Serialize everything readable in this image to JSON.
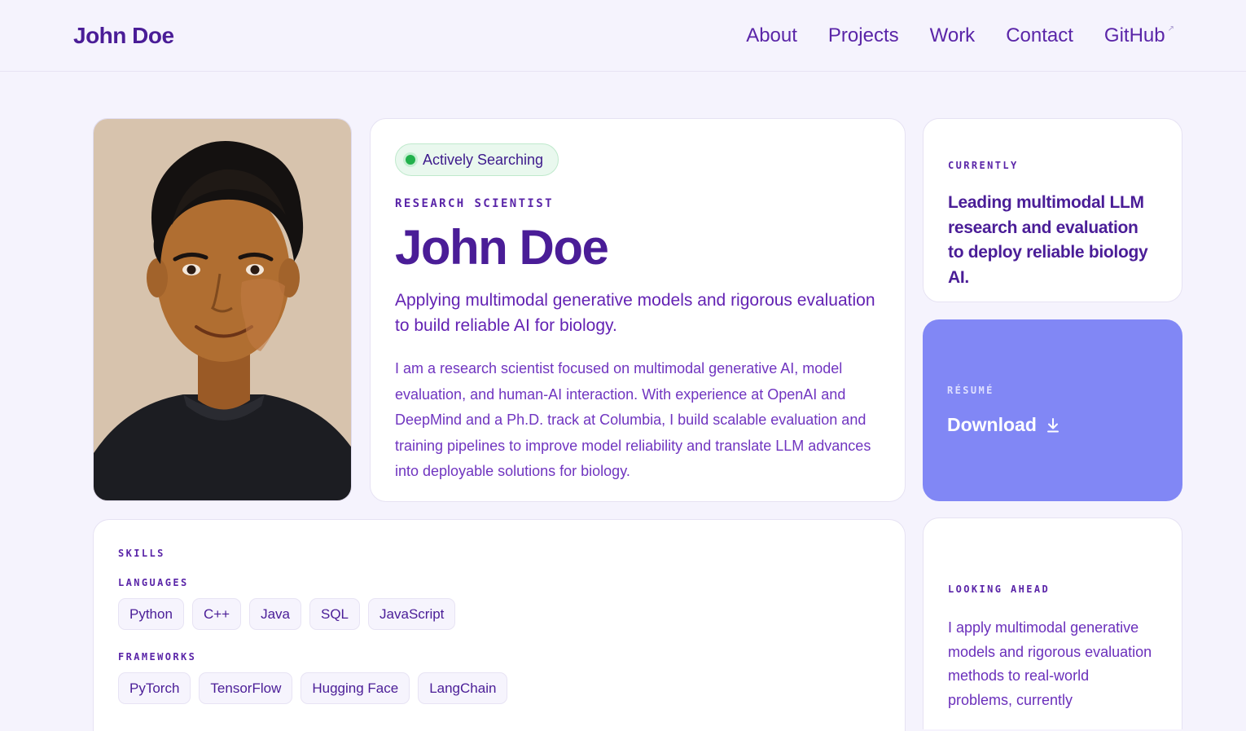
{
  "header": {
    "brand": "John Doe",
    "nav": [
      {
        "label": "About"
      },
      {
        "label": "Projects"
      },
      {
        "label": "Work"
      },
      {
        "label": "Contact"
      },
      {
        "label": "GitHub",
        "external_glyph": "↗"
      }
    ]
  },
  "hero": {
    "status": "Actively Searching",
    "role": "RESEARCH SCIENTIST",
    "name": "John Doe",
    "tagline": "Applying multimodal generative models and rigorous evaluation to build reliable AI for biology.",
    "bio": "I am a research scientist focused on multimodal generative AI, model evaluation, and human-AI interaction. With experience at OpenAI and DeepMind and a Ph.D. track at Columbia, I build scalable evaluation and training pipelines to improve model reliability and translate LLM advances into deployable solutions for biology.",
    "status_color": "#22b14c"
  },
  "currently": {
    "label": "CURRENTLY",
    "text": "Leading multimodal LLM research and evaluation to deploy reliable biology AI."
  },
  "resume": {
    "label": "RÉSUMÉ",
    "action": "Download",
    "icon": "download-icon",
    "bg_color": "#8187f5"
  },
  "skills": {
    "label": "SKILLS",
    "languages_label": "LANGUAGES",
    "languages": [
      "Python",
      "C++",
      "Java",
      "SQL",
      "JavaScript"
    ],
    "frameworks_label": "FRAMEWORKS",
    "frameworks": [
      "PyTorch",
      "TensorFlow",
      "Hugging Face",
      "LangChain"
    ]
  },
  "looking_ahead": {
    "label": "LOOKING AHEAD",
    "text": "I apply multimodal generative models and rigorous evaluation methods to real-world problems, currently"
  },
  "theme": {
    "accent": "#4a1d97",
    "background": "#f5f3fd"
  }
}
